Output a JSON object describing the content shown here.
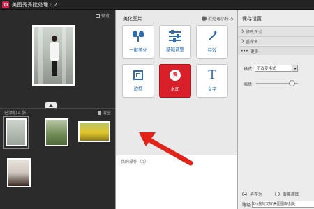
{
  "app": {
    "title": "美图秀秀批处理1.2"
  },
  "left_panel": {
    "preview_label": "预览",
    "added_label": "已添加 4 张",
    "clear_label": "清空",
    "thumbnail_count": 4
  },
  "center_panel": {
    "section_title": "美化图片",
    "tips_label": "批处理小技巧",
    "tools": [
      {
        "label": "一键美化",
        "icon": "tulip-icon"
      },
      {
        "label": "基础调整",
        "icon": "sliders-icon"
      },
      {
        "label": "特效",
        "icon": "magic-wand-icon"
      },
      {
        "label": "边框",
        "icon": "frame-icon"
      },
      {
        "label": "水印",
        "icon": "stamp-icon",
        "stamp_char": "秀"
      },
      {
        "label": "文字",
        "icon": "text-icon",
        "glyph": "T"
      }
    ],
    "ops_label": "我的操作（0）"
  },
  "right_panel": {
    "title": "保存设置",
    "rows": [
      "修改尺寸",
      "重命名",
      "更多"
    ],
    "format_label": "格式",
    "format_value": "不改变格式",
    "quality_label": "画质",
    "quality_fraction": 0.85,
    "save_as_label": "另存为",
    "overwrite_label": "覆盖原图",
    "path_label": "路径",
    "path_value": "D:\\我的文档\\美图图库\\批处"
  },
  "colors": {
    "accent_red": "#d81f2a",
    "icon_blue": "#2e6db4",
    "arrow_red": "#e2231a"
  }
}
